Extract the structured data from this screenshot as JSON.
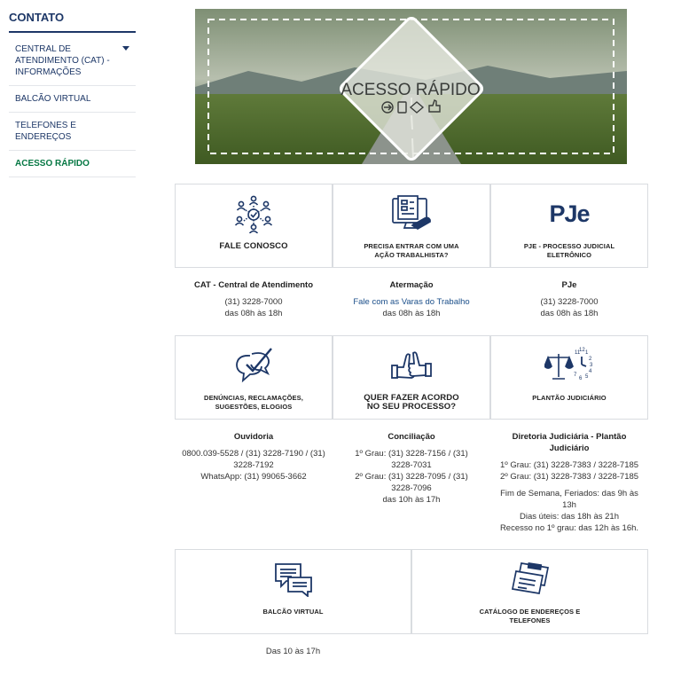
{
  "sidebar": {
    "title": "CONTATO",
    "items": [
      {
        "label": "CENTRAL DE ATENDIMENTO (CAT) - INFORMAÇÕES"
      },
      {
        "label": "BALCÃO VIRTUAL"
      },
      {
        "label": "TELEFONES E ENDEREÇOS"
      },
      {
        "label": "ACESSO RÁPIDO"
      }
    ]
  },
  "banner": {
    "title": "ACESSO RÁPIDO"
  },
  "cards": {
    "fale": {
      "label": "FALE CONOSCO",
      "icon": "people-network-icon"
    },
    "acao": {
      "label": "PRECISA ENTRAR COM UMA AÇÃO TRABALHISTA?",
      "icon": "computer-form-icon"
    },
    "pje": {
      "label": "PJE - PROCESSO JUDICIAL ELETRÔNICO",
      "logo": "PJe",
      "icon": "pje-logo"
    },
    "denuncias": {
      "label": "DENÚNCIAS, RECLAMAÇÕES, SUGESTÕES, ELOGIOS",
      "icon": "chat-check-icon"
    },
    "acordo": {
      "label": "QUER FAZER ACORDO NO SEU PROCESSO?",
      "icon": "handshake-thumbs-icon"
    },
    "plantao": {
      "label": "PLANTÃO JUDICIÁRIO",
      "icon": "scales-clock-icon"
    },
    "balcao": {
      "label": "BALCÃO VIRTUAL",
      "icon": "chat-bubbles-icon"
    },
    "catalogo": {
      "label": "CATÁLOGO DE ENDEREÇOS E TELEFONES",
      "icon": "address-cards-icon"
    }
  },
  "info": {
    "cat": {
      "title": "CAT - Central de Atendimento",
      "line1": "(31) 3228-7000",
      "line2": "das 08h às 18h"
    },
    "atermacao": {
      "title": "Atermação",
      "link": "Fale com as Varas do Trabalho",
      "line2": "das 08h às 18h"
    },
    "pje": {
      "title": "PJe",
      "line1": "(31) 3228-7000",
      "line2": "das 08h às 18h"
    },
    "ouvidoria": {
      "title": "Ouvidoria",
      "line1": "0800.039-5528 / (31) 3228-7190 / (31) 3228-7192",
      "line2": "WhatsApp: (31) 99065-3662"
    },
    "conciliacao": {
      "title": "Conciliação",
      "line1": "1º Grau: (31) 3228-7156 / (31) 3228-7031",
      "line2": "2º Grau: (31) 3228-7095 / (31) 3228-7096",
      "line3": "das 10h às 17h"
    },
    "diretoria": {
      "title": "Diretoria Judiciária - Plantão Judiciário",
      "line1": "1º Grau: (31) 3228-7383 / 3228-7185",
      "line2": "2º Grau: (31) 3228-7383 / 3228-7185",
      "line3": "Fim de Semana, Feriados: das 9h às 13h",
      "line4": "Dias úteis: das 18h às 21h",
      "line5": "Recesso no 1º grau: das 12h às 16h."
    },
    "balcao": {
      "line1": "Das 10 às 17h"
    }
  },
  "colors": {
    "navy": "#1d3767",
    "green": "#067844",
    "link": "#1b4f8a",
    "border": "#d9dce0"
  }
}
